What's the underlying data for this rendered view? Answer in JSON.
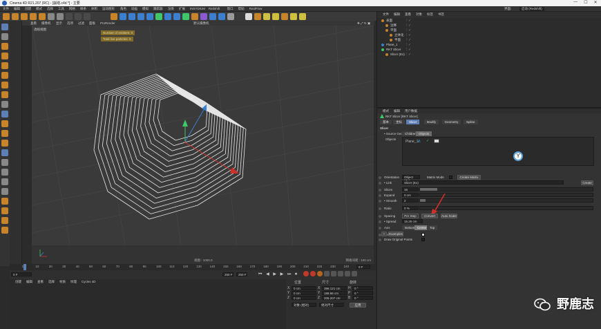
{
  "window": {
    "title": "Cinema 4D R21.207 (RC) - [崩塔.c4d *] - 主要",
    "controls": [
      "—",
      "☐",
      "✕"
    ]
  },
  "menubar": {
    "items": [
      "文件",
      "编辑",
      "创建",
      "模式",
      "选择",
      "工具",
      "网格",
      "样条",
      "体积",
      "运动图形",
      "角色",
      "动画",
      "模拟",
      "跟踪器",
      "渲染",
      "扩展",
      "INSYDIUM",
      "Redshift",
      "窗口",
      "帮助",
      "RealFlow"
    ],
    "layout_label": "界面:",
    "layout_value": "启动 (Redshift)"
  },
  "viewport": {
    "menu": [
      "查看",
      "摄像机",
      "显示",
      "选项",
      "过滤",
      "面板",
      "ProRender"
    ],
    "view_name": "透视视图",
    "camera": "默认摄像机",
    "info_emitters": "Number of emitters: 0",
    "info_particles": "Total live particles: 0",
    "bottom_label": "视图 : 1000.0",
    "grid_label": "网格间距 : 100 cm"
  },
  "timeline": {
    "ticks": [
      "0",
      "5",
      "10",
      "15",
      "20",
      "25",
      "30",
      "35",
      "40",
      "45",
      "50",
      "55",
      "60",
      "65",
      "70",
      "75",
      "80",
      "85",
      "90",
      "95",
      "100",
      "105",
      "110",
      "115",
      "120",
      "125",
      "130",
      "135",
      "140",
      "145",
      "150",
      "155",
      "160",
      "165",
      "170",
      "175",
      "180",
      "185",
      "190",
      "195",
      "200",
      "205",
      "210",
      "215",
      "220",
      "225",
      "230",
      "235",
      "240",
      "245",
      "250"
    ],
    "current_frame": "0 F",
    "start": "0 F",
    "end": "250 F",
    "end2": "250 F",
    "frame_right": "0 F"
  },
  "material_panel": {
    "menu": [
      "创建",
      "编辑",
      "查看",
      "选择",
      "材质",
      "纹理",
      "Cycles 4D"
    ]
  },
  "coords": {
    "headers": [
      "位置",
      "尺寸",
      "旋转"
    ],
    "rows": [
      {
        "axis": "X",
        "pos": "0 cm",
        "size_axis": "X",
        "size": "386.121 cm",
        "rot_axis": "H",
        "rot": "0 °"
      },
      {
        "axis": "Y",
        "pos": "0 cm",
        "size_axis": "Y",
        "size": "188.86 cm",
        "rot_axis": "P",
        "rot": "0 °"
      },
      {
        "axis": "Z",
        "pos": "0 cm",
        "size_axis": "Z",
        "size": "205.207 cm",
        "rot_axis": "B",
        "rot": "0 °"
      }
    ],
    "mode": "对象 (相对)",
    "size_mode": "绝对尺寸",
    "apply": "应用"
  },
  "object_manager": {
    "menu": [
      "文件",
      "编辑",
      "查看",
      "对象",
      "标签",
      "书签"
    ],
    "objects": [
      {
        "name": "表面",
        "indent": 0
      },
      {
        "name": "注释",
        "indent": 1
      },
      {
        "name": "平面",
        "indent": 1
      },
      {
        "name": "立体化",
        "indent": 2
      },
      {
        "name": "平面",
        "indent": 2
      },
      {
        "name": "Plane_1",
        "indent": 0
      },
      {
        "name": "RKT Slicer",
        "indent": 0
      },
      {
        "name": "Slicer (Ex)",
        "indent": 1
      }
    ]
  },
  "attributes": {
    "menu": [
      "模式",
      "编辑",
      "用户数据"
    ],
    "object_title": "RKT Slicer [RKT Slicer]",
    "tabs": [
      "基本",
      "坐标",
      "Slicer",
      "Modify",
      "Geometry",
      "Spline"
    ],
    "active_tab": "Slicer",
    "section": "Slicer",
    "source_label": "• Source Geo",
    "source_options": [
      "Children",
      "Objects"
    ],
    "objects_label": "Objects",
    "objects_item": "Plane_1",
    "orientation_label": "Orientation",
    "orientation_value": "Object (Z+)",
    "matrix_mode_label": "Matrix Mode",
    "create_matrix": "Create Matrix",
    "link_label": "• Link",
    "link_value": "Slicer (Ex)",
    "create": "Create",
    "slices_label": "Slices",
    "slices_value": "16",
    "expand_label": "Expand",
    "expand_value": "0 cm",
    "smooth_label": "• Smooth",
    "smooth_value": "2",
    "ratio_label": "Ratio",
    "ratio_value": "0 %",
    "spacing_label": "Spacing",
    "spacing_options": [
      "Per Step",
      "Convert",
      "Auto Scale"
    ],
    "spread_label": "• Spread",
    "spread_value": "15.25 cm",
    "axis_label": "Axis",
    "axis_options": [
      "Bottom",
      "Center",
      "Top"
    ],
    "active_axis": "Center",
    "preview_cuts": "Preview Cuts",
    "draw_original": "Draw Original Points",
    "examples": "Examples",
    "plus": "+"
  },
  "sliders": {
    "slices": 0.1,
    "expand": 0.0,
    "smooth": 0.03
  },
  "watermark": {
    "text": "野鹿志"
  },
  "colors": {
    "accent_tab": "#5e7fb6",
    "axis_red": "#d0302a",
    "axis_green": "#3ec86a",
    "axis_blue": "#3a7fd0",
    "info_box": "#7f6a2a"
  }
}
